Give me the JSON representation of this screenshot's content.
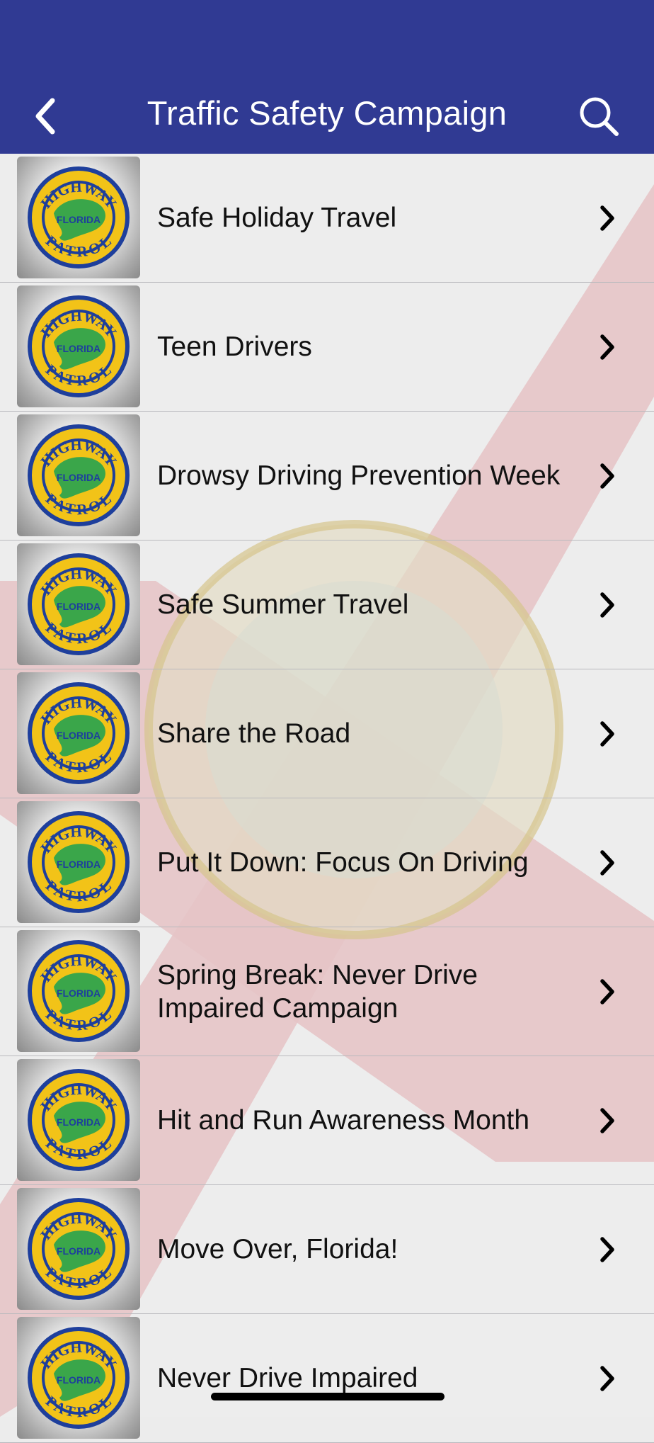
{
  "header": {
    "title": "Traffic Safety Campaign",
    "back_icon": "chevron-left-icon",
    "search_icon": "search-icon",
    "background_color": "#303a93"
  },
  "badge": {
    "top_text": "HIGHWAY",
    "center_text": "FLORIDA",
    "bottom_text": "PATROL"
  },
  "campaigns": [
    {
      "label": "Safe Holiday Travel"
    },
    {
      "label": "Teen Drivers"
    },
    {
      "label": "Drowsy Driving Prevention Week"
    },
    {
      "label": "Safe Summer Travel"
    },
    {
      "label": "Share the Road"
    },
    {
      "label": "Put It Down: Focus On Driving"
    },
    {
      "label": "Spring Break: Never Drive Impaired Campaign"
    },
    {
      "label": "Hit and Run Awareness Month"
    },
    {
      "label": "Move Over, Florida!"
    },
    {
      "label": "Never Drive Impaired"
    }
  ]
}
